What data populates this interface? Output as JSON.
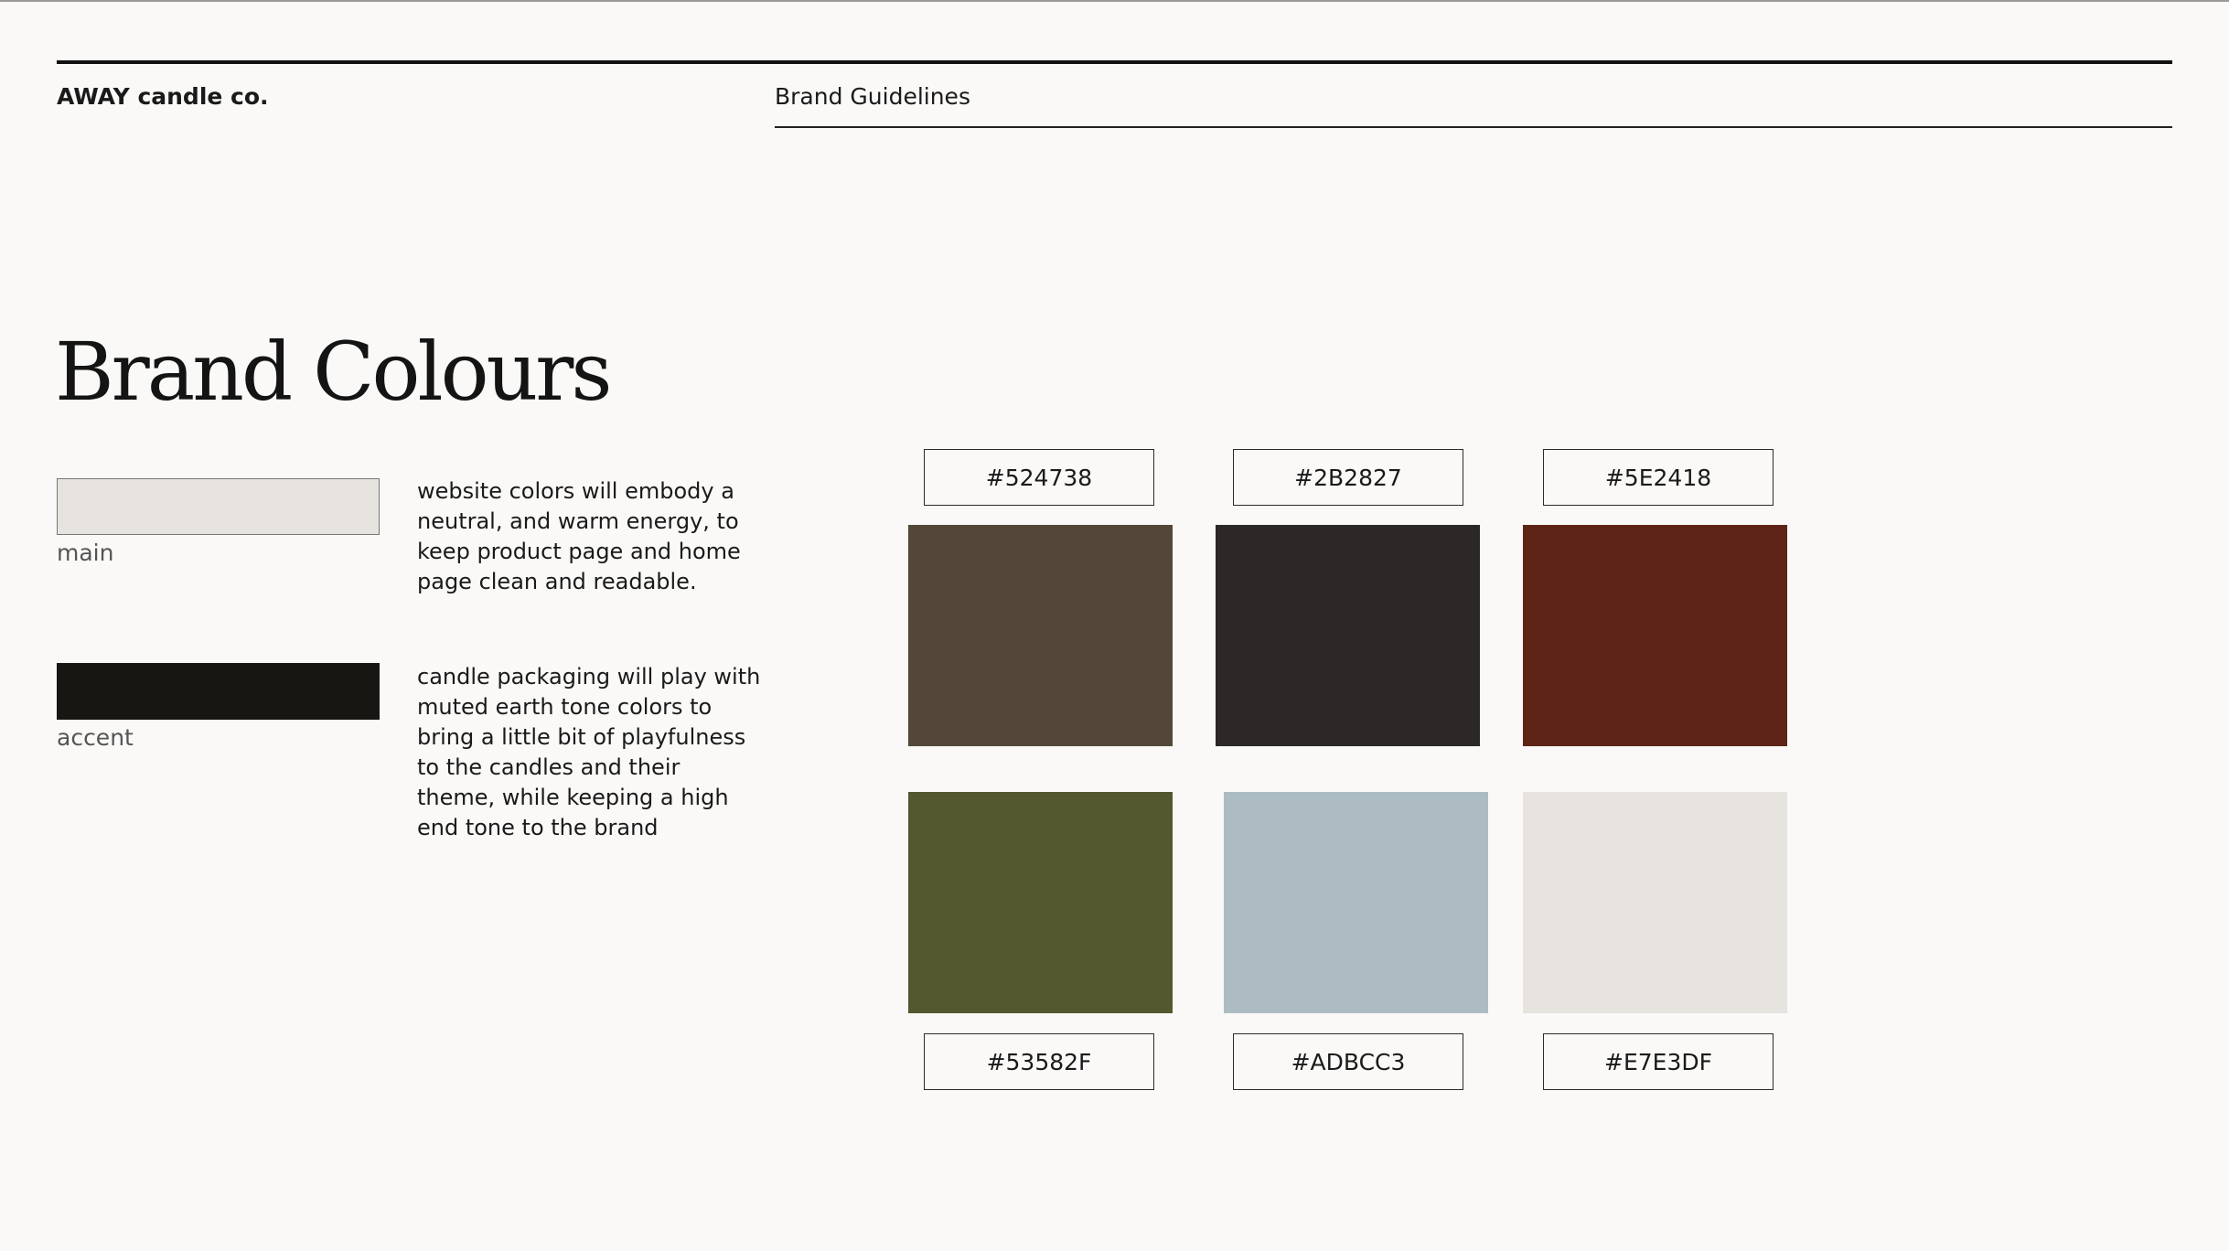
{
  "header": {
    "brand": "AWAY candle co.",
    "doc_title": "Brand Guidelines"
  },
  "section": {
    "title": "Brand Colours"
  },
  "website_palette": [
    {
      "label": "main",
      "color": "#E7E3DF",
      "description": "website colors will embody a neutral, and warm energy, to keep product page and home page clean and readable."
    },
    {
      "label": "accent",
      "color": "#171613",
      "description": "candle packaging will play with muted earth tone colors to bring a little bit of playfulness to the candles and their theme, while keeping a high end tone to the brand"
    }
  ],
  "packaging_palette": [
    {
      "hex": "#524738",
      "color": "#524738"
    },
    {
      "hex": "#2B2827",
      "color": "#2B2827"
    },
    {
      "hex": "#5E2418",
      "color": "#5E2418"
    },
    {
      "hex": "#53582F",
      "color": "#53582F"
    },
    {
      "hex": "#ADBCC3",
      "color": "#ADBCC3"
    },
    {
      "hex": "#E7E3DF",
      "color": "#E7E3DF"
    }
  ]
}
